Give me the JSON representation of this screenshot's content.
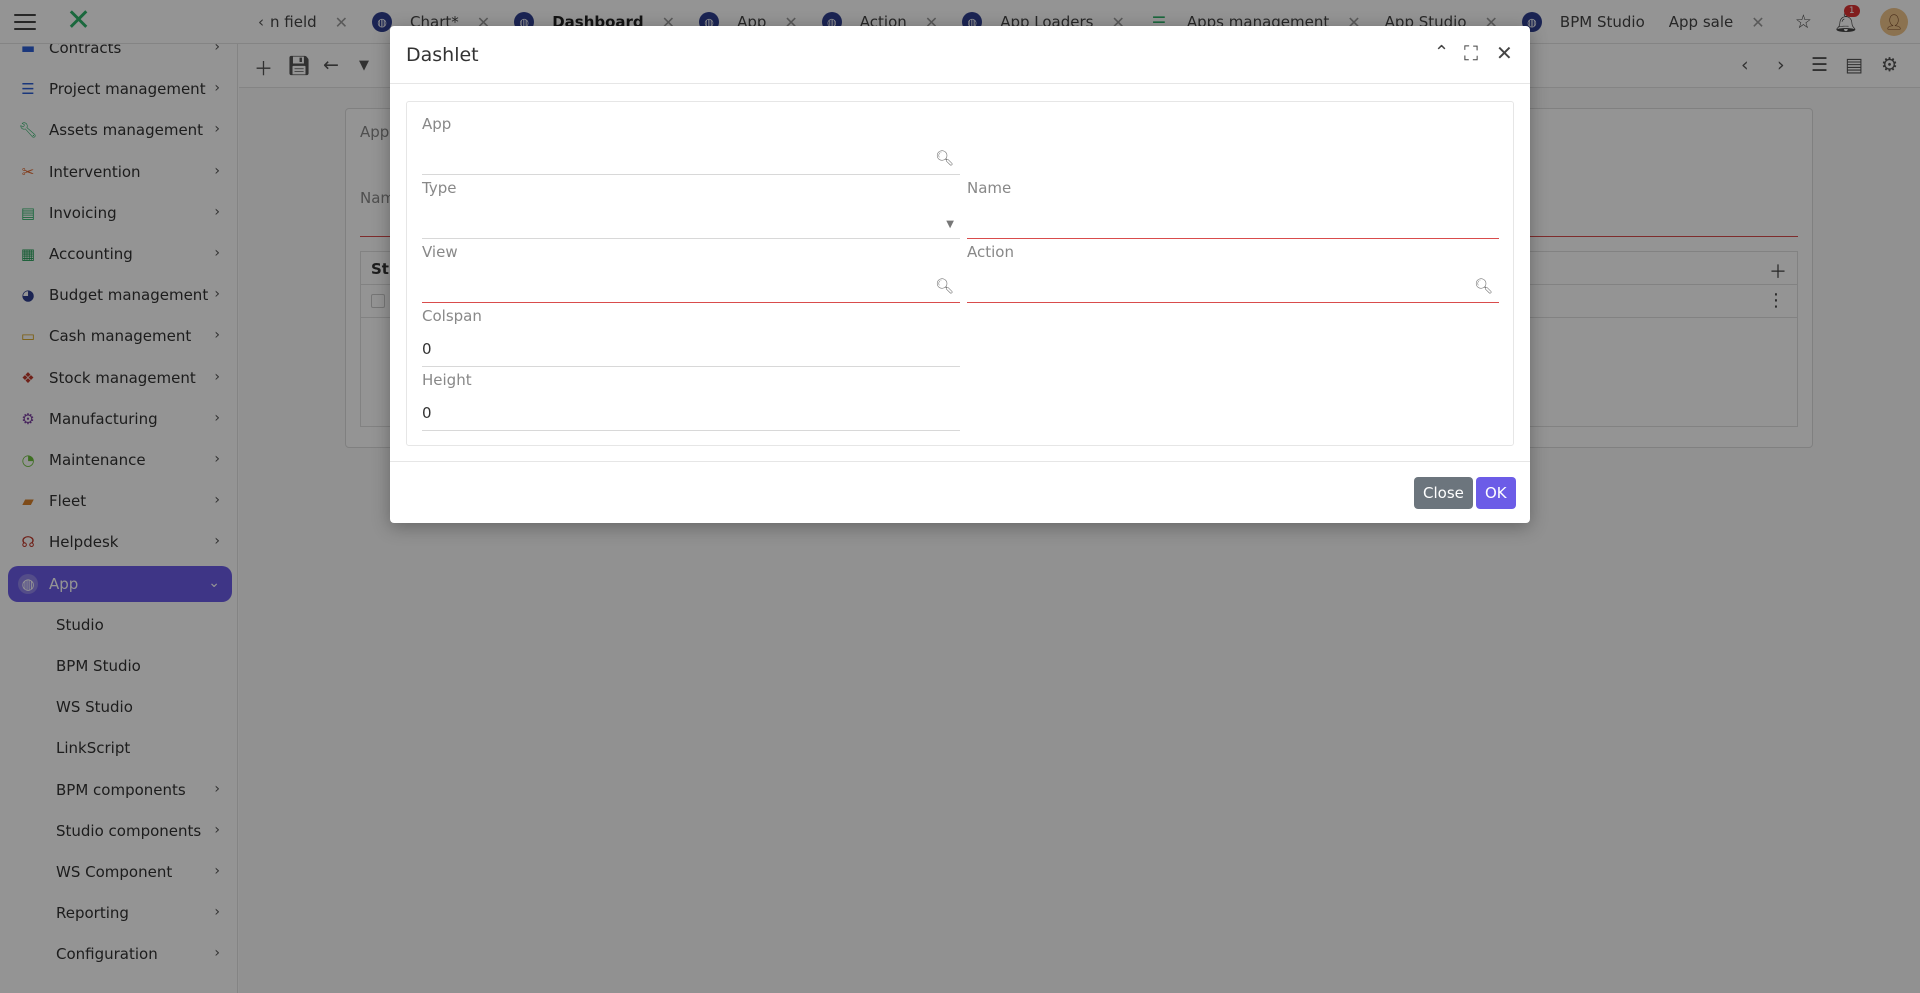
{
  "topbar": {
    "tabs": [
      {
        "label": "n field",
        "icon": "chevron-left-icon"
      },
      {
        "label": "Chart*",
        "icon": "app-icon"
      },
      {
        "label": "Dashboard",
        "icon": "app-icon",
        "active": true
      },
      {
        "label": "App",
        "icon": "app-icon"
      },
      {
        "label": "Action",
        "icon": "app-icon"
      },
      {
        "label": "App Loaders",
        "icon": "app-icon"
      },
      {
        "label": "Apps management",
        "icon": "settings-sliders-icon"
      },
      {
        "label": "App Studio",
        "icon": ""
      },
      {
        "label": "BPM Studio",
        "icon": "app-icon"
      },
      {
        "label": "App sale",
        "icon": ""
      }
    ],
    "notification_count": "1"
  },
  "sidebar": {
    "items": [
      {
        "label": "Contracts",
        "icon": "contract-icon",
        "color": "#2d5fd6"
      },
      {
        "label": "Project management",
        "icon": "list-icon",
        "color": "#2d5fd6"
      },
      {
        "label": "Assets management",
        "icon": "wrench-icon",
        "color": "#2db36a"
      },
      {
        "label": "Intervention",
        "icon": "tools-icon",
        "color": "#e0662d"
      },
      {
        "label": "Invoicing",
        "icon": "invoice-icon",
        "color": "#2db36a"
      },
      {
        "label": "Accounting",
        "icon": "calculator-icon",
        "color": "#1f9e55"
      },
      {
        "label": "Budget management",
        "icon": "pie-chart-icon",
        "color": "#2f3f8f"
      },
      {
        "label": "Cash management",
        "icon": "cash-icon",
        "color": "#d4a017"
      },
      {
        "label": "Stock management",
        "icon": "boxes-icon",
        "color": "#c0392b"
      },
      {
        "label": "Manufacturing",
        "icon": "gear-icon",
        "color": "#7b3fa0"
      },
      {
        "label": "Maintenance",
        "icon": "maintenance-icon",
        "color": "#6bbf3a"
      },
      {
        "label": "Fleet",
        "icon": "car-icon",
        "color": "#d9822b"
      },
      {
        "label": "Helpdesk",
        "icon": "headset-icon",
        "color": "#c0392b"
      },
      {
        "label": "App",
        "icon": "app-icon",
        "color": "#ffffff",
        "active": true
      },
      {
        "label": "Studio",
        "sub": true
      },
      {
        "label": "BPM Studio",
        "sub": true
      },
      {
        "label": "WS Studio",
        "sub": true
      },
      {
        "label": "LinkScript",
        "sub": true
      },
      {
        "label": "BPM components",
        "sub": true,
        "chevron": true
      },
      {
        "label": "Studio components",
        "sub": true,
        "chevron": true
      },
      {
        "label": "WS Component",
        "sub": true,
        "chevron": true
      },
      {
        "label": "Reporting",
        "sub": true,
        "chevron": true
      },
      {
        "label": "Configuration",
        "sub": true,
        "chevron": true
      }
    ]
  },
  "background": {
    "label_app": "App",
    "label_name": "Nam",
    "panel_header": "St"
  },
  "dialog": {
    "title": "Dashlet",
    "fields": {
      "app": {
        "label": "App",
        "value": ""
      },
      "type": {
        "label": "Type",
        "value": ""
      },
      "name": {
        "label": "Name",
        "value": ""
      },
      "view": {
        "label": "View",
        "value": ""
      },
      "action": {
        "label": "Action",
        "value": ""
      },
      "colspan": {
        "label": "Colspan",
        "value": "0"
      },
      "height": {
        "label": "Height",
        "value": "0"
      }
    },
    "buttons": {
      "close": "Close",
      "ok": "OK"
    }
  },
  "colors": {
    "accent": "#6c5ce7",
    "required": "#d94c4c",
    "secondary_button": "#6c757d"
  }
}
